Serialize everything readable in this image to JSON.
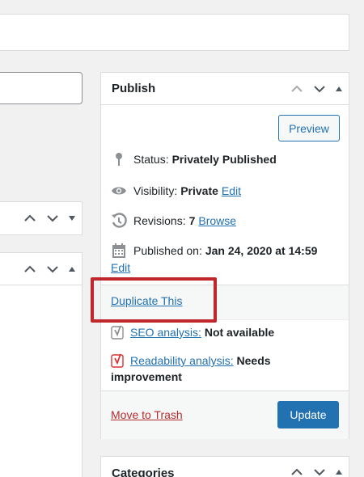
{
  "publish": {
    "title": "Publish",
    "preview_label": "Preview",
    "status_label": "Status:",
    "status_value": "Privately Published",
    "visibility_label": "Visibility:",
    "visibility_value": "Private",
    "visibility_edit": "Edit",
    "revisions_label": "Revisions:",
    "revisions_value": "7",
    "revisions_browse": "Browse",
    "published_label": "Published on:",
    "published_value": "Jan 24, 2020 at 14:59",
    "published_edit": "Edit",
    "duplicate_label": "Duplicate This",
    "seo_link": "SEO analysis:",
    "seo_value": "Not available",
    "readability_link": "Readability analysis:",
    "readability_value": "Needs",
    "readability_value_2": "improvement",
    "trash_label": "Move to Trash",
    "update_label": "Update"
  },
  "categories": {
    "title": "Categories"
  },
  "icons": {
    "status": "pin-icon",
    "visibility": "eye-icon",
    "revisions": "history-icon",
    "published": "calendar-icon",
    "seo": "yoast-icon",
    "readability": "yoast-icon"
  },
  "colors": {
    "link": "#2271b1",
    "primary_button": "#2271b1",
    "trash": "#b32d2e",
    "highlight": "#c0272d",
    "readability_icon": "#dc3232"
  }
}
